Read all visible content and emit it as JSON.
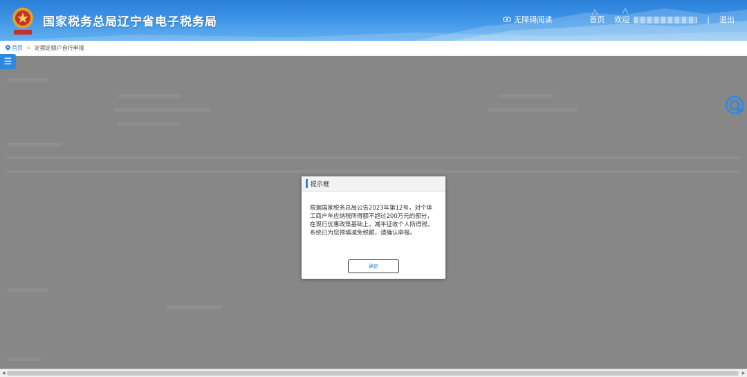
{
  "header": {
    "site_title": "国家税务总局辽宁省电子税务局",
    "emblem_text": "中国税务",
    "accessible_reading": "无障碍阅读",
    "home": "首页",
    "welcome": "欢迎",
    "separator": "|",
    "logout": "退出"
  },
  "breadcrumb": {
    "home": "首页",
    "arrow": ">",
    "current": "定期定额户自行申报"
  },
  "menu_toggle": {
    "label": "☰"
  },
  "modal": {
    "title": "提示框",
    "message": "根据国家税务总局公告2023年第12号，对个体工商户年应纳税所得额不超过200万元的部分，在现行优惠政策基础上，减半征收个人所得税。系统已为您预填减免税额，请确认申报。",
    "confirm_label": "确定"
  },
  "colors": {
    "header_blue": "#2a7fd8",
    "overlay_grey": "#878787",
    "accent_blue": "#2f88e0"
  }
}
